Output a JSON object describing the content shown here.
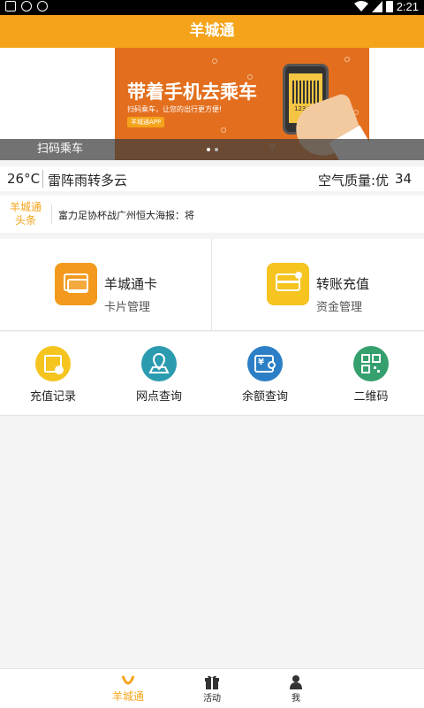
{
  "status_bar": {
    "time": "2:21"
  },
  "app": {
    "title": "羊城通"
  },
  "banner": {
    "headline": "带着手机去乘车",
    "subline": "扫码乘车，让您的出行更方便!",
    "tag": "羊城通APP",
    "phone_code": "12345",
    "caption": "扫码乘车",
    "pages": 2,
    "active_page": 1
  },
  "weather": {
    "temperature": "26°C",
    "condition": "雷阵雨转多云",
    "air_quality_label": "空气质量:优",
    "air_quality_value": "34"
  },
  "news": {
    "tag_line1": "羊城通",
    "tag_line2": "头条",
    "headline": "富力足协杯战广州恒大海报：将"
  },
  "cards": [
    {
      "title": "羊城通卡",
      "subtitle": "卡片管理",
      "icon": "card-stack-icon",
      "color": "#f39a1e"
    },
    {
      "title": "转账充值",
      "subtitle": "资金管理",
      "icon": "card-transfer-icon",
      "color": "#f5c41e"
    }
  ],
  "grid": [
    {
      "label": "充值记录",
      "icon": "recharge-record-icon",
      "color": "#f5c41e"
    },
    {
      "label": "网点查询",
      "icon": "map-location-icon",
      "color": "#2b9bb0"
    },
    {
      "label": "余额查询",
      "icon": "balance-search-icon",
      "color": "#2c7fc6"
    },
    {
      "label": "二维码",
      "icon": "qr-code-icon",
      "color": "#35a06e"
    }
  ],
  "tabs": [
    {
      "label": "羊城通",
      "icon": "ycard-logo-icon",
      "active": true
    },
    {
      "label": "活动",
      "icon": "gift-icon",
      "active": false
    },
    {
      "label": "我",
      "icon": "person-icon",
      "active": false
    }
  ],
  "colors": {
    "brand": "#f5a31a",
    "banner_bg": "#e36f1e"
  }
}
